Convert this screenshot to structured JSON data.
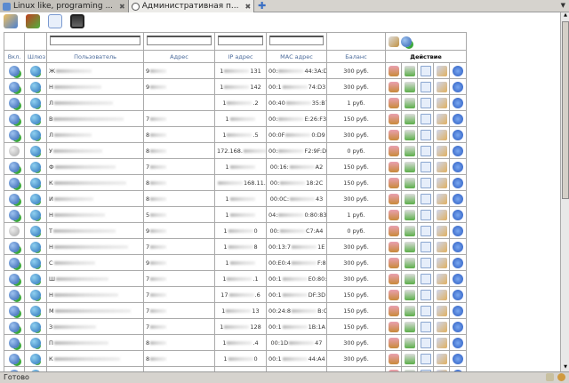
{
  "tabs": [
    {
      "label": "Linux like, programing ...",
      "active": false
    },
    {
      "label": "Административная п...",
      "active": true
    }
  ],
  "toolbar": {
    "icons": [
      "users-group-icon",
      "add-user-icon",
      "document-icon",
      "save-disk-icon"
    ]
  },
  "table": {
    "headers": {
      "enabled": "Вкл.",
      "gateway": "Шлюз",
      "user": "Пользователь",
      "address": "Адрес",
      "ip": "IP адрес",
      "mac": "MAC адрес",
      "balance": "Баланс",
      "action": "Действие"
    },
    "rows": [
      {
        "on": true,
        "user": "Ж",
        "addr": "9",
        "ip": [
          "1",
          "131"
        ],
        "mac": [
          "00:",
          "44:3A:D1"
        ],
        "balance": "300 руб."
      },
      {
        "on": true,
        "user": "Н",
        "addr": "9",
        "ip": [
          "1",
          "142"
        ],
        "mac": [
          "00:1",
          "74:D3"
        ],
        "balance": "300 руб."
      },
      {
        "on": true,
        "user": "Л",
        "addr": "",
        "ip": [
          "1",
          ".2"
        ],
        "mac": [
          "00:40",
          "35:B7"
        ],
        "balance": "1 руб."
      },
      {
        "on": true,
        "user": "В",
        "addr": "7",
        "ip": [
          "1",
          ""
        ],
        "mac": [
          "00:",
          "E:26:F3"
        ],
        "balance": "150 руб."
      },
      {
        "on": true,
        "user": "Л",
        "addr": "8",
        "ip": [
          "1",
          ".5"
        ],
        "mac": [
          "00:0F",
          "0:D9"
        ],
        "balance": "300 руб."
      },
      {
        "on": false,
        "user": "У",
        "addr": "8",
        "ip": [
          "172.168.",
          ".7"
        ],
        "mac": [
          "00:",
          "F2:9F:D9"
        ],
        "balance": "0 руб."
      },
      {
        "on": true,
        "user": "Ф",
        "addr": "7",
        "ip": [
          "1",
          ""
        ],
        "mac": [
          "00:16:",
          "A2"
        ],
        "balance": "150 руб."
      },
      {
        "on": true,
        "user": "К",
        "addr": "8",
        "ip": [
          "",
          "168.11.230"
        ],
        "mac": [
          "00:",
          "18:2C"
        ],
        "balance": "150 руб."
      },
      {
        "on": true,
        "user": "И",
        "addr": "8",
        "ip": [
          "1",
          ""
        ],
        "mac": [
          "00:0C:",
          "43"
        ],
        "balance": "300 руб."
      },
      {
        "on": true,
        "user": "Н",
        "addr": "5",
        "ip": [
          "1",
          ""
        ],
        "mac": [
          "04:",
          "0:80:83"
        ],
        "balance": "1 руб."
      },
      {
        "on": false,
        "user": "Т",
        "addr": "9",
        "ip": [
          "1",
          "0"
        ],
        "mac": [
          "00:",
          "C7:A4"
        ],
        "balance": "0 руб."
      },
      {
        "on": true,
        "user": "Н",
        "addr": "7",
        "ip": [
          "1",
          "8"
        ],
        "mac": [
          "00:13:7",
          "1E"
        ],
        "balance": "300 руб."
      },
      {
        "on": true,
        "user": "С",
        "addr": "9",
        "ip": [
          "1",
          ""
        ],
        "mac": [
          "00:E0:4",
          "F:81"
        ],
        "balance": "300 руб."
      },
      {
        "on": true,
        "user": "Ш",
        "addr": "7",
        "ip": [
          "1",
          ".1"
        ],
        "mac": [
          "00:1",
          "E0:80:65"
        ],
        "balance": "300 руб."
      },
      {
        "on": true,
        "user": "Н",
        "addr": "7",
        "ip": [
          "17",
          ".6"
        ],
        "mac": [
          "00:1",
          "DF:3D"
        ],
        "balance": "150 руб."
      },
      {
        "on": true,
        "user": "М",
        "addr": "7",
        "ip": [
          "1",
          "13"
        ],
        "mac": [
          "00:24:8",
          "B:C1"
        ],
        "balance": "150 руб."
      },
      {
        "on": true,
        "user": "З",
        "addr": "7",
        "ip": [
          "1",
          "128"
        ],
        "mac": [
          "00:1",
          "1B:1A"
        ],
        "balance": "150 руб."
      },
      {
        "on": true,
        "user": "П",
        "addr": "8",
        "ip": [
          "1",
          ".4"
        ],
        "mac": [
          "00:1D",
          "47"
        ],
        "balance": "300 руб."
      },
      {
        "on": true,
        "user": "К",
        "addr": "8",
        "ip": [
          "1",
          "0"
        ],
        "mac": [
          "00:1",
          "44:A4"
        ],
        "balance": "300 руб."
      },
      {
        "on": true,
        "user": "",
        "addr": "",
        "ip": [
          "",
          ""
        ],
        "mac": [
          "",
          ""
        ],
        "balance": ""
      }
    ]
  },
  "status": {
    "text": "Готово"
  }
}
